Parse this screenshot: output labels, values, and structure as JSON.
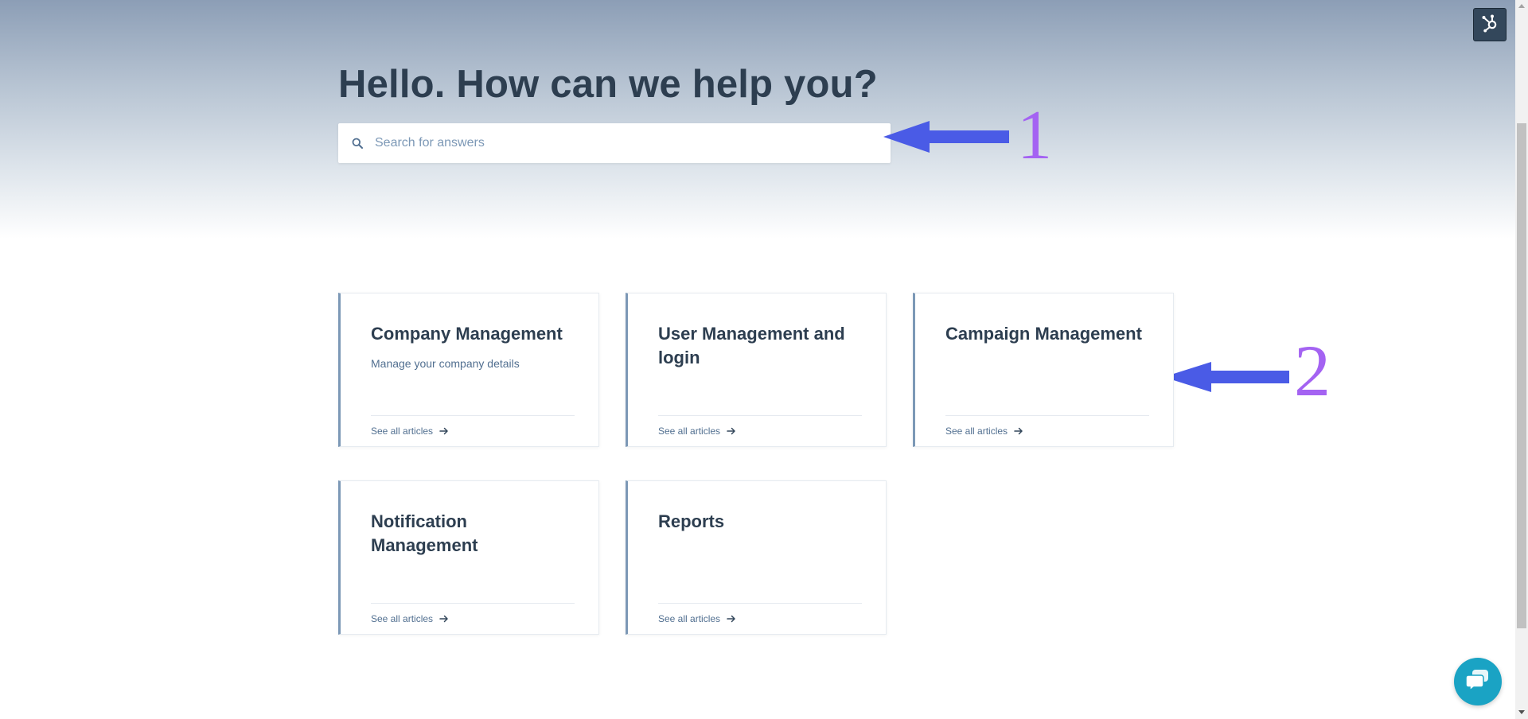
{
  "hero": {
    "title": "Hello. How can we help you?"
  },
  "search": {
    "placeholder": "Search for answers",
    "value": ""
  },
  "annotations": [
    {
      "label": "1"
    },
    {
      "label": "2"
    }
  ],
  "categories": [
    {
      "title": "Company Management",
      "description": "Manage your company details",
      "link": "See all articles"
    },
    {
      "title": "User Management and login",
      "description": "",
      "link": "See all articles"
    },
    {
      "title": "Campaign Management",
      "description": "",
      "link": "See all articles"
    },
    {
      "title": "Notification Management",
      "description": "",
      "link": "See all articles"
    },
    {
      "title": "Reports",
      "description": "",
      "link": "See all articles"
    }
  ],
  "colors": {
    "heading": "#2d3e50",
    "card_accent": "#7c98b6",
    "annotation_arrow": "#4a5be6",
    "annotation_number": "#a463f2",
    "chat_button": "#1aa3c4"
  },
  "icons": {
    "search": "search-icon",
    "arrow": "arrow-right-icon",
    "hubspot": "hubspot-sprocket-icon",
    "chat": "chat-bubble-icon"
  }
}
